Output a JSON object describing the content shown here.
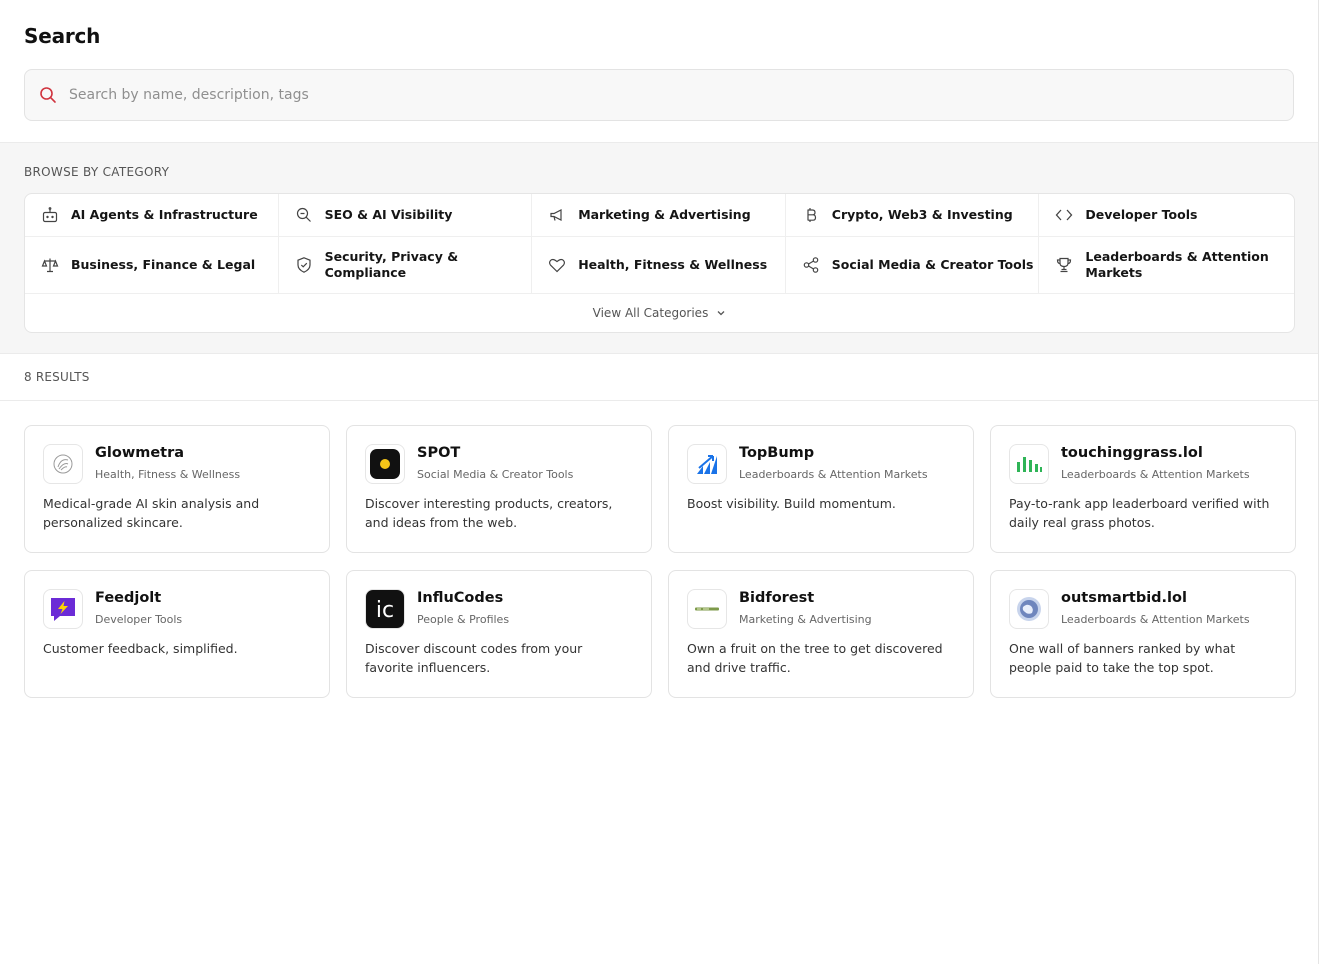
{
  "header": {
    "title": "Search",
    "search_placeholder": "Search by name, description, tags",
    "search_value": ""
  },
  "categories": {
    "label": "BROWSE BY CATEGORY",
    "row1": [
      {
        "label": "AI Agents & Infrastructure",
        "icon": "robot-icon"
      },
      {
        "label": "SEO & AI Visibility",
        "icon": "search-zoom-icon"
      },
      {
        "label": "Marketing & Advertising",
        "icon": "megaphone-icon"
      },
      {
        "label": "Crypto, Web3 & Investing",
        "icon": "bitcoin-icon"
      },
      {
        "label": "Developer Tools",
        "icon": "code-icon"
      }
    ],
    "row2": [
      {
        "label": "Business, Finance & Legal",
        "icon": "scales-icon"
      },
      {
        "label": "Security, Privacy & Compliance",
        "icon": "shield-icon"
      },
      {
        "label": "Health, Fitness & Wellness",
        "icon": "heart-icon"
      },
      {
        "label": "Social Media & Creator Tools",
        "icon": "share-icon"
      },
      {
        "label": "Leaderboards & Attention Markets",
        "icon": "trophy-icon"
      }
    ],
    "view_all": "View All Categories"
  },
  "results": {
    "count_label": "8 RESULTS",
    "items": [
      {
        "name": "Glowmetra",
        "category": "Health, Fitness & Wellness",
        "description": "Medical-grade AI skin analysis and personalized skincare.",
        "logo": "glowmetra-logo"
      },
      {
        "name": "SPOT",
        "category": "Social Media & Creator Tools",
        "description": "Discover interesting products, creators, and ideas from the web.",
        "logo": "spot-logo"
      },
      {
        "name": "TopBump",
        "category": "Leaderboards & Attention Markets",
        "description": "Boost visibility. Build momentum.",
        "logo": "topbump-logo"
      },
      {
        "name": "touchinggrass.lol",
        "category": "Leaderboards & Attention Markets",
        "description": "Pay-to-rank app leaderboard verified with daily real grass photos.",
        "logo": "touchinggrass-logo"
      },
      {
        "name": "Feedjolt",
        "category": "Developer Tools",
        "description": "Customer feedback, simplified.",
        "logo": "feedjolt-logo"
      },
      {
        "name": "InfluCodes",
        "category": "People & Profiles",
        "description": "Discover discount codes from your favorite influencers.",
        "logo": "influcodes-logo",
        "logo_text": "ic"
      },
      {
        "name": "Bidforest",
        "category": "Marketing & Advertising",
        "description": "Own a fruit on the tree to get discovered and drive traffic.",
        "logo": "bidforest-logo"
      },
      {
        "name": "outsmartbid.lol",
        "category": "Leaderboards & Attention Markets",
        "description": "One wall of banners ranked by what people paid to take the top spot.",
        "logo": "outsmartbid-logo"
      }
    ]
  },
  "colors": {
    "search_icon": "#d0343f",
    "spot_yellow": "#f5c518",
    "topbump_blue": "#1a73e8",
    "touchinggrass_green": "#2fb457",
    "feedjolt_purple": "#6b2bd6",
    "feedjolt_yellow": "#ffd400"
  }
}
